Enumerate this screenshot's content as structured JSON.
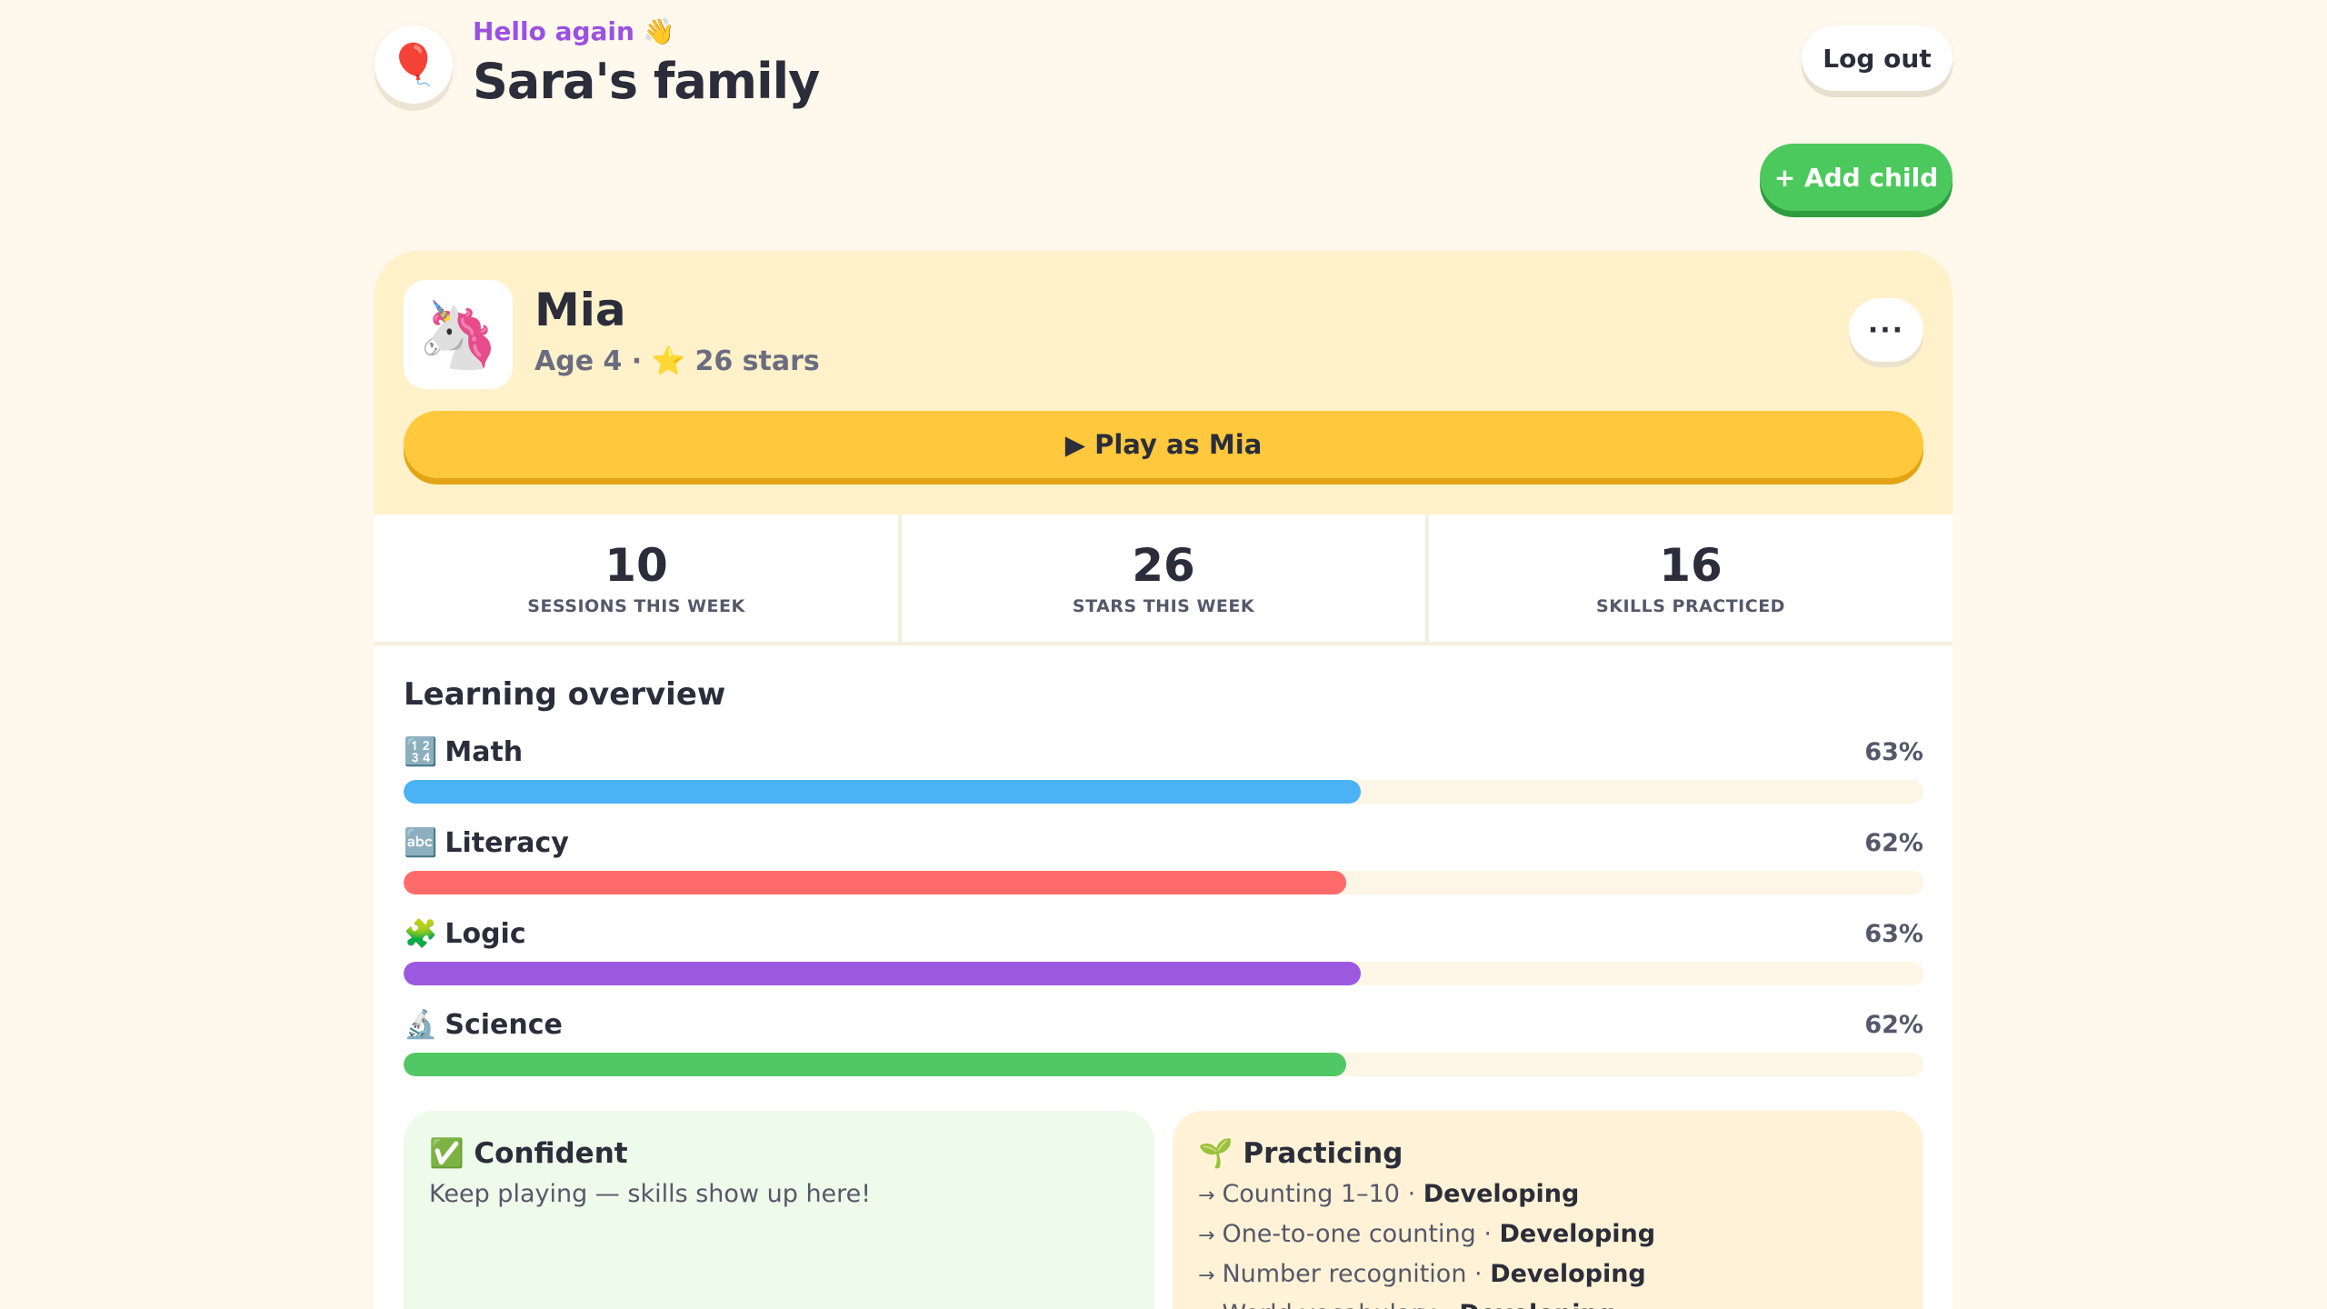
{
  "header": {
    "logo_glyph": "🎈",
    "greeting": "Hello again 👋",
    "family_title": "Sara's family",
    "logout_label": "Log out",
    "add_child_label": "+ Add child"
  },
  "child": {
    "avatar_glyph": "🦄",
    "name": "Mia",
    "meta": "Age 4 · ⭐ 26 stars",
    "more_label": "···",
    "play_label": "▶ Play as Mia"
  },
  "stats": [
    {
      "value": "10",
      "label": "SESSIONS THIS WEEK"
    },
    {
      "value": "26",
      "label": "STARS THIS WEEK"
    },
    {
      "value": "16",
      "label": "SKILLS PRACTICED"
    }
  ],
  "overview": {
    "title": "Learning overview",
    "subjects": [
      {
        "icon": "🔢",
        "name": "Math",
        "percent_label": "63%",
        "percent": 63,
        "color": "#4bb3f5"
      },
      {
        "icon": "🔤",
        "name": "Literacy",
        "percent_label": "62%",
        "percent": 62,
        "color": "#ff6b6b"
      },
      {
        "icon": "🧩",
        "name": "Logic",
        "percent_label": "63%",
        "percent": 63,
        "color": "#9b59e0"
      },
      {
        "icon": "🔬",
        "name": "Science",
        "percent_label": "62%",
        "percent": 62,
        "color": "#52c766"
      }
    ]
  },
  "confident": {
    "title": "✅ Confident",
    "text": "Keep playing — skills show up here!"
  },
  "practicing": {
    "title": "🌱 Practicing",
    "items": [
      {
        "arrow": "→",
        "skill": "Counting 1–10 · ",
        "level": "Developing"
      },
      {
        "arrow": "→",
        "skill": "One-to-one counting · ",
        "level": "Developing"
      },
      {
        "arrow": "→",
        "skill": "Number recognition · ",
        "level": "Developing"
      },
      {
        "arrow": "→",
        "skill": "World vocabulary · ",
        "level": "Developing"
      }
    ]
  },
  "colors": {
    "background": "#fff8ec",
    "accent_purple": "#9b51e0",
    "add_green": "#4cc95c",
    "play_yellow": "#ffc83d"
  }
}
